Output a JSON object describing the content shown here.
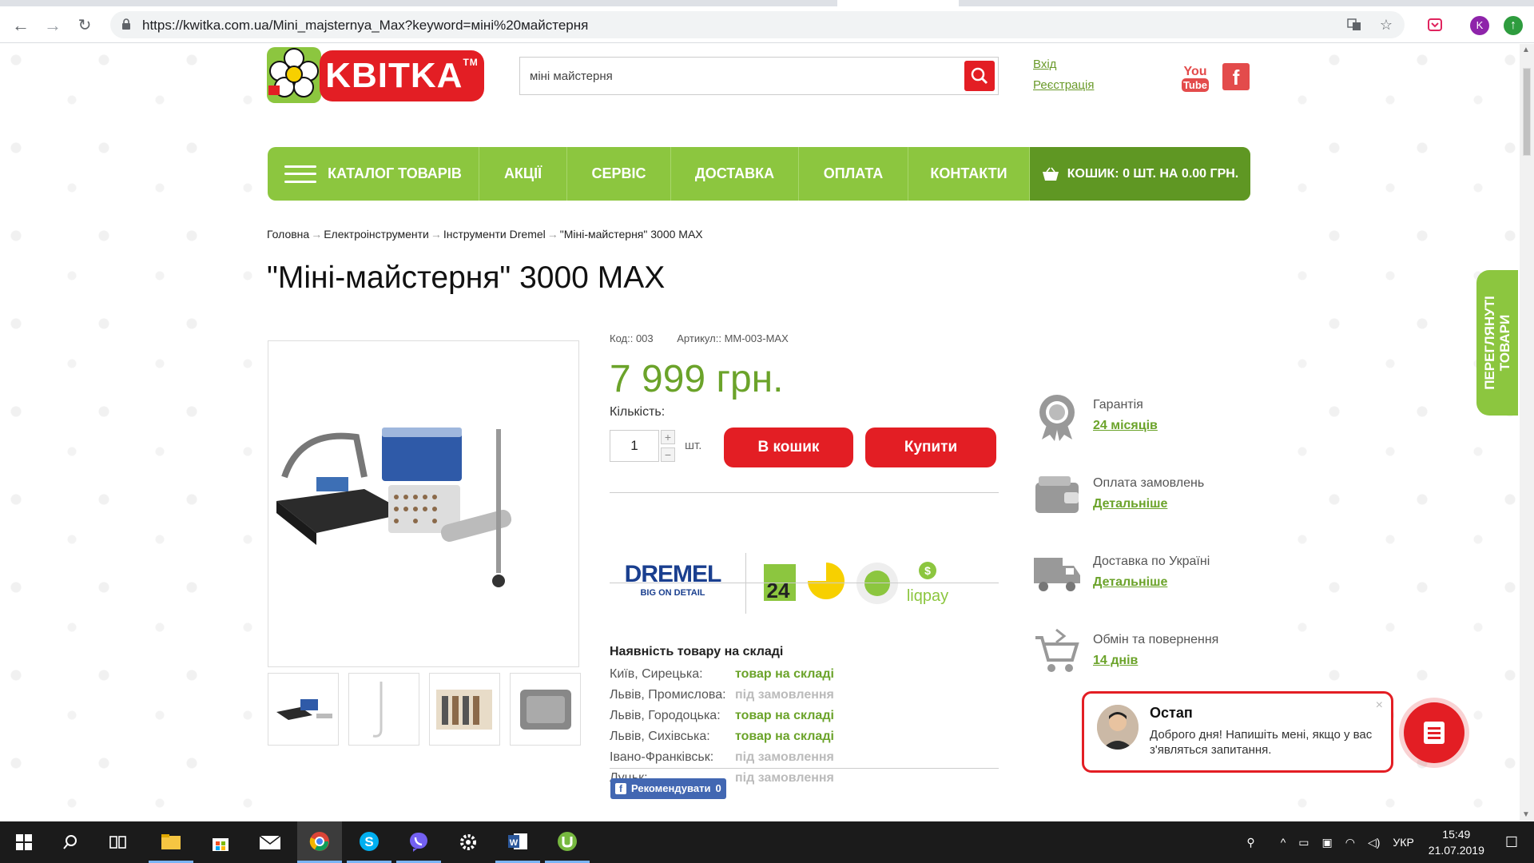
{
  "browser": {
    "url": "https://kwitka.com.ua/Mini_majsternya_Max?keyword=міні%20майстерня",
    "profile_initial": "K"
  },
  "header": {
    "logo_text": "KBITKA",
    "logo_tm": "TM",
    "search_value": "міні майстерня",
    "login_label": "Вхід",
    "register_label": "Реєстрація",
    "youtube_label_top": "You",
    "youtube_label_bottom": "Tube",
    "facebook_label": "f"
  },
  "nav": {
    "items": [
      "Каталог товарів",
      "Акції",
      "Сервіс",
      "Доставка",
      "Оплата",
      "Контакти"
    ],
    "cart_label": "Кошик: 0 шт. на 0.00 грн."
  },
  "breadcrumb": [
    "Головна",
    "Електроінструменти",
    "Інструменти Dremel",
    "\"Міні-майстерня\" 3000 MAX"
  ],
  "breadcrumb_sep": "→",
  "product": {
    "title": "\"Міні-майстерня\" 3000 MAX",
    "code": "Код:: 003",
    "sku": "Артикул:: MM-003-MAX",
    "price": "7 999 грн.",
    "qty_label": "Кількість:",
    "qty_value": "1",
    "qty_plus": "+",
    "qty_minus": "−",
    "unit": "шт.",
    "add_to_cart": "В кошик",
    "buy": "Купити"
  },
  "brands": {
    "dremel_name": "DREMEL",
    "dremel_slogan": "BIG ON DETAIL",
    "privat_label": "24",
    "liqpay_label": "liqpay",
    "liqpay_symbol": "$"
  },
  "stock": {
    "title": "Наявність товару на складі",
    "rows": [
      {
        "city": "Київ, Сирецька:",
        "status": "товар на складі",
        "in_stock": true
      },
      {
        "city": "Львів, Промислова:",
        "status": "під замовлення",
        "in_stock": false
      },
      {
        "city": "Львів, Городоцька:",
        "status": "товар на складі",
        "in_stock": true
      },
      {
        "city": "Львів, Сихівська:",
        "status": "товар на складі",
        "in_stock": true
      },
      {
        "city": "Івано-Франківськ:",
        "status": "під замовлення",
        "in_stock": false
      },
      {
        "city": "Луцьк:",
        "status": "під замовлення",
        "in_stock": false
      }
    ]
  },
  "fb_like": {
    "label": "Рекомендувати",
    "count": "0",
    "icon": "f"
  },
  "features": [
    {
      "title": "Гарантія",
      "link": "24 місяців",
      "icon": "award-icon"
    },
    {
      "title": "Оплата замовлень",
      "link": "Детальніше",
      "icon": "wallet-icon"
    },
    {
      "title": "Доставка по Україні",
      "link": "Детальніше",
      "icon": "truck-icon"
    },
    {
      "title": "Обмін та повернення",
      "link": "14 днів",
      "icon": "return-cart-icon"
    }
  ],
  "viewed_tab": {
    "line1": "ПЕРЕГЛЯНУТІ",
    "line2": "ТОВАРИ"
  },
  "chat": {
    "name": "Остап",
    "message": "Доброго дня! Напишіть мені, якщо у вас з'являться запитання.",
    "close": "×"
  },
  "taskbar": {
    "language": "УКР",
    "time": "15:49",
    "date": "21.07.2019"
  },
  "colors": {
    "brand_red": "#e31e24",
    "brand_green": "#8cc63f",
    "dark_green": "#5f9723",
    "price_green": "#6ba32a"
  }
}
